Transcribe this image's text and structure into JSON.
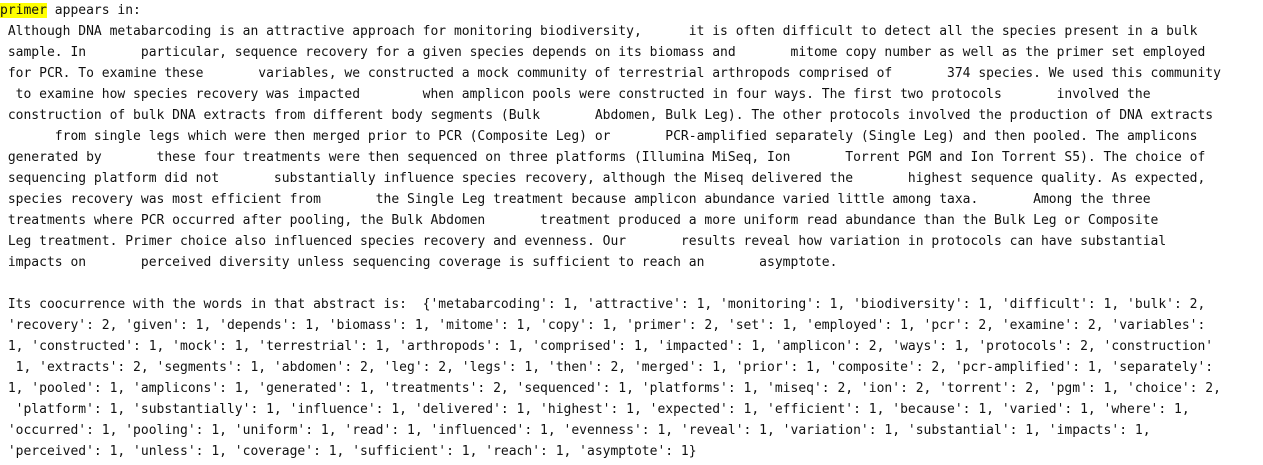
{
  "header": {
    "highlight_word": "primer",
    "suffix": " appears in:"
  },
  "abstract_lines": [
    " Although DNA metabarcoding is an attractive approach for monitoring biodiversity,      it is often difficult to detect all the species present in a bulk",
    " sample. In       particular, sequence recovery for a given species depends on its biomass and       mitome copy number as well as the primer set employed",
    " for PCR. To examine these       variables, we constructed a mock community of terrestrial arthropods comprised of       374 species. We used this community",
    "  to examine how species recovery was impacted        when amplicon pools were constructed in four ways. The first two protocols       involved the",
    " construction of bulk DNA extracts from different body segments (Bulk       Abdomen, Bulk Leg). The other protocols involved the production of DNA extracts",
    "       from single legs which were then merged prior to PCR (Composite Leg) or       PCR-amplified separately (Single Leg) and then pooled. The amplicons",
    " generated by       these four treatments were then sequenced on three platforms (Illumina MiSeq, Ion       Torrent PGM and Ion Torrent S5). The choice of",
    " sequencing platform did not       substantially influence species recovery, although the Miseq delivered the       highest sequence quality. As expected,",
    " species recovery was most efficient from       the Single Leg treatment because amplicon abundance varied little among taxa.       Among the three",
    " treatments where PCR occurred after pooling, the Bulk Abdomen       treatment produced a more uniform read abundance than the Bulk Leg or Composite",
    " Leg treatment. Primer choice also influenced species recovery and evenness. Our       results reveal how variation in protocols can have substantial",
    " impacts on       perceived diversity unless sequencing coverage is sufficient to reach an       asymptote."
  ],
  "cooccurrence_lines": [
    " Its coocurrence with the words in that abstract is:  {'metabarcoding': 1, 'attractive': 1, 'monitoring': 1, 'biodiversity': 1, 'difficult': 1, 'bulk': 2,",
    " 'recovery': 2, 'given': 1, 'depends': 1, 'biomass': 1, 'mitome': 1, 'copy': 1, 'primer': 2, 'set': 1, 'employed': 1, 'pcr': 2, 'examine': 2, 'variables':",
    " 1, 'constructed': 1, 'mock': 1, 'terrestrial': 1, 'arthropods': 1, 'comprised': 1, 'impacted': 1, 'amplicon': 2, 'ways': 1, 'protocols': 2, 'construction'",
    "  1, 'extracts': 2, 'segments': 1, 'abdomen': 2, 'leg': 2, 'legs': 1, 'then': 2, 'merged': 1, 'prior': 1, 'composite': 2, 'pcr-amplified': 1, 'separately':",
    " 1, 'pooled': 1, 'amplicons': 1, 'generated': 1, 'treatments': 2, 'sequenced': 1, 'platforms': 1, 'miseq': 2, 'ion': 2, 'torrent': 2, 'pgm': 1, 'choice': 2,",
    "  'platform': 1, 'substantially': 1, 'influence': 1, 'delivered': 1, 'highest': 1, 'expected': 1, 'efficient': 1, 'because': 1, 'varied': 1, 'where': 1,",
    " 'occurred': 1, 'pooling': 1, 'uniform': 1, 'read': 1, 'influenced': 1, 'evenness': 1, 'reveal': 1, 'variation': 1, 'substantial': 1, 'impacts': 1,",
    " 'perceived': 1, 'unless': 1, 'coverage': 1, 'sufficient': 1, 'reach': 1, 'asymptote': 1}"
  ]
}
